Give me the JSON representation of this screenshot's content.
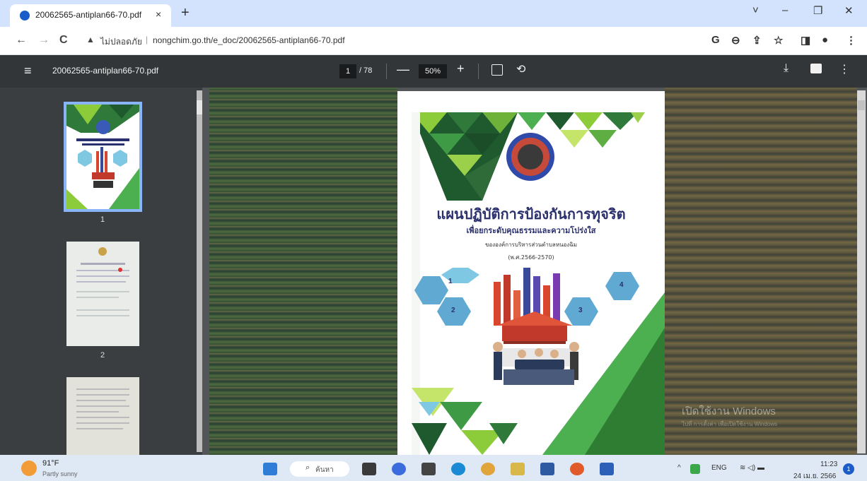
{
  "browser": {
    "tab_title": "20062565-antiplan66-70.pdf",
    "tab_close": "×",
    "new_tab": "+",
    "controls": {
      "chevron": "˅",
      "minimize": "–",
      "restore": "❐",
      "close": "✕"
    }
  },
  "address_bar": {
    "back": "←",
    "forward": "→",
    "reload": "C",
    "warning_icon": "▲",
    "security_label": "ไม่ปลอดภัย",
    "separator": "|",
    "url": "nongchim.go.th/e_doc/20062565-antiplan66-70.pdf",
    "toolbar_icons": {
      "google": "G",
      "zoom": "⊖",
      "share": "⇪",
      "bookmark": "☆",
      "sidebar": "◨",
      "profile": "●",
      "menu": "⋮"
    }
  },
  "pdf_toolbar": {
    "menu_icon": "≡",
    "title": "20062565-antiplan66-70.pdf",
    "current_page": "1",
    "total_pages": "/ 78",
    "zoom_out": "—",
    "zoom": "50%",
    "zoom_in": "+",
    "rotate_icon": "⟲",
    "download_icon": "⤓",
    "more_icon": "⋮"
  },
  "sidebar": {
    "thumbnails": [
      {
        "number": "1",
        "active": true
      },
      {
        "number": "2",
        "active": false
      },
      {
        "number": "",
        "active": false
      }
    ]
  },
  "page": {
    "title": "แผนปฏิบัติการป้องกันการทุจริต",
    "subtitle": "เพื่อยกระดับคุณธรรมและความโปร่งใส",
    "organization": "ขององค์การบริหารส่วนตำบลหนองฉิม",
    "years": "(พ.ศ.2566-2570)",
    "badges": [
      "1",
      "2",
      "3",
      "4"
    ]
  },
  "watermark": {
    "line1": "เปิดใช้งาน Windows",
    "line2": "ไปที่ การตั้งค่า เพื่อเปิดใช้งาน Windows"
  },
  "taskbar": {
    "temperature": "91°F",
    "weather": "Partly sunny",
    "search_icon": "⌕",
    "search_label": "ค้นหา",
    "tray_up": "^",
    "language": "ENG",
    "tray_icons": "≋ ◁) ▬",
    "time": "11:23",
    "date": "24 เม.ย. 2566",
    "notification_count": "1"
  },
  "colors": {
    "tab_strip": "#d3e3fd",
    "pdf_toolbar": "#323639",
    "thumb_active": "#8ab4f8",
    "title_navy": "#2a2f6e",
    "taskbar": "#dfe9f5"
  }
}
